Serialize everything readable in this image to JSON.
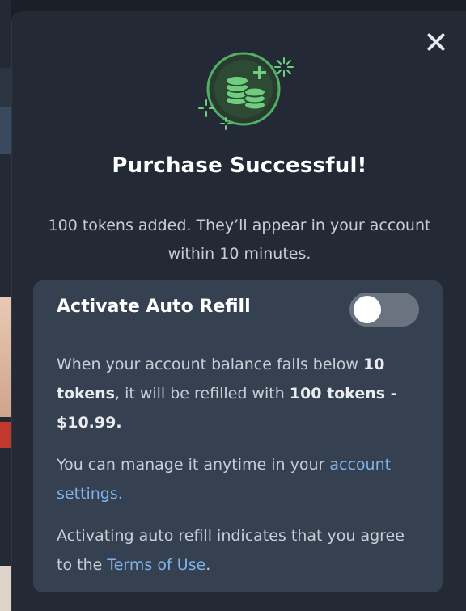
{
  "modal": {
    "title": "Purchase Successful!",
    "subtitle": "100 tokens added. They’ll appear in your account within 10 minutes.",
    "close_icon": "close-icon",
    "hero_icon": "coins-plus-icon"
  },
  "auto_refill": {
    "title": "Activate Auto Refill",
    "toggle_on": false,
    "desc_part1": "When your account balance falls below ",
    "threshold": "10 tokens",
    "desc_part2": ", it will be refilled with ",
    "refill": "100 tokens - $10.99.",
    "manage_text": "You can manage it anytime in your ",
    "manage_link": "account settings.",
    "terms_text": "Activating auto refill indicates that you agree to the ",
    "terms_link": "Terms of Use",
    "terms_end": "."
  },
  "colors": {
    "accent_green": "#4fb063",
    "link_blue": "#7fb2ea",
    "modal_bg": "#232a35",
    "card_bg": "#354050"
  }
}
